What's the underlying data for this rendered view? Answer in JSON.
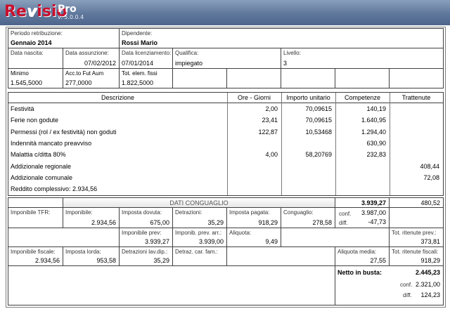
{
  "app": {
    "logo_pre": "Re",
    "logo_v": "v",
    "logo_post": "isio",
    "pro": "Pro",
    "version": "v. 5.0.0.4"
  },
  "top": {
    "periodo_label": "Periodo retribuzione:",
    "periodo_value": "Gennaio 2014",
    "dipendente_label": "Dipendente:",
    "dipendente_value": "Rossi Mario",
    "nascita_label": "Data nascita:",
    "nascita_value": "",
    "assunzione_label": "Data assunzione:",
    "assunzione_value": "07/02/2012",
    "licenziamento_label": "Data licenziamento:",
    "licenziamento_value": "07/01/2014",
    "qualifica_label": "Qualifica:",
    "qualifica_value": "impiegato",
    "livello_label": "Livello:",
    "livello_value": "3",
    "minimo_label": "Minimo",
    "minimo_value": "1.545,5000",
    "acc_label": "Acc.to Fut Aum",
    "acc_value": "277,0000",
    "tot_label": "Tot. elem. fissi",
    "tot_value": "1.822,5000"
  },
  "table": {
    "headers": {
      "descrizione": "Descrizione",
      "ore": "Ore - Giorni",
      "importo": "Importo unitario",
      "competenze": "Competenze",
      "trattenute": "Trattenute"
    },
    "rows": [
      {
        "desc": "Festività",
        "ore": "2,00",
        "imp": "70,09615",
        "comp": "140,19",
        "tratt": ""
      },
      {
        "desc": "Ferie non godute",
        "ore": "23,41",
        "imp": "70,09615",
        "comp": "1.640,95",
        "tratt": ""
      },
      {
        "desc": "Permessi (rol / ex festività) non goduti",
        "ore": "122,87",
        "imp": "10,53468",
        "comp": "1.294,40",
        "tratt": ""
      },
      {
        "desc": "Indennità mancato preavviso",
        "ore": "",
        "imp": "",
        "comp": "630,90",
        "tratt": ""
      },
      {
        "desc": "Malattia c/ditta 80%",
        "ore": "4,00",
        "imp": "58,20769",
        "comp": "232,83",
        "tratt": ""
      },
      {
        "desc": "Addizionale regionale",
        "ore": "",
        "imp": "",
        "comp": "",
        "tratt": "408,44"
      },
      {
        "desc": "Addizionale comunale",
        "ore": "",
        "imp": "",
        "comp": "",
        "tratt": "72,08"
      },
      {
        "desc": "Reddito complessivo: 2.934,56",
        "ore": "",
        "imp": "",
        "comp": "",
        "tratt": ""
      }
    ]
  },
  "conguaglio": {
    "title": "DATI CONGUAGLIO",
    "tot_comp": "3.939,27",
    "tot_tratt": "480,52",
    "imponibile_tfr_label": "Imponibile TFR:",
    "imponibile_label": "Imponibile:",
    "imponibile_value": "2.934,56",
    "imposta_dovuta_label": "Imposta dovuta:",
    "imposta_dovuta_value": "675,00",
    "detrazioni_label": "Detrazioni:",
    "detrazioni_value": "35,29",
    "imposta_pagata_label": "Imposta pagata:",
    "imposta_pagata_value": "918,29",
    "conguaglio_label": "Conguaglio:",
    "conguaglio_value": "278,58",
    "conf_label": "conf.",
    "conf_value": "3.987,00",
    "diff_label": "diff.",
    "diff_value": "-47,73",
    "imp_prev_label": "Imponibile prev:",
    "imp_prev_value": "3.939,27",
    "imp_prev_arr_label": "Imponib. prev. arr.:",
    "imp_prev_arr_value": "3.939,00",
    "aliquota_label": "Aliquota:",
    "aliquota_value": "9,49",
    "tot_rit_prev_label": "Tot. ritenute prev.:",
    "tot_rit_prev_value": "373,81",
    "imp_fiscale_label": "Imponibile fiscale:",
    "imp_fiscale_value": "2.934,56",
    "imposta_lorda_label": "Imposta lorda:",
    "imposta_lorda_value": "953,58",
    "detr_lav_label": "Detrazioni lav.dip.:",
    "detr_lav_value": "35,29",
    "detr_fam_label": "Detraz. car. fam.:",
    "detr_fam_value": "",
    "aliquota_media_label": "Aliquota media:",
    "aliquota_media_value": "27,55",
    "tot_rit_fisc_label": "Tot. ritenute fiscali:",
    "tot_rit_fisc_value": "918,29",
    "netto_label": "Netto in busta:",
    "netto_value": "2.445,23",
    "netto_conf_label": "conf.",
    "netto_conf_value": "2.321,00",
    "netto_diff_label": "diff.",
    "netto_diff_value": "124,23"
  }
}
